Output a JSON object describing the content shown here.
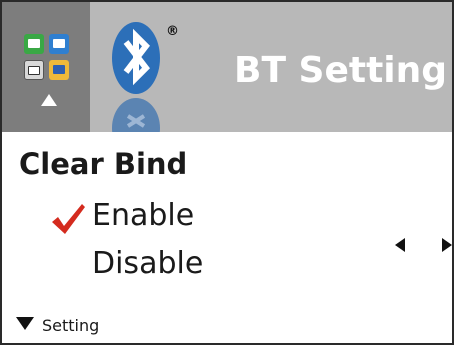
{
  "header": {
    "title": "BT Setting",
    "registered_mark": "®",
    "menu_icon": "menu-grid-icon",
    "bluetooth_icon": "bluetooth-icon"
  },
  "section": {
    "title": "Clear Bind"
  },
  "options": [
    {
      "label": "Enable",
      "selected": true
    },
    {
      "label": "Disable",
      "selected": false
    }
  ],
  "footer": {
    "label": "Setting"
  },
  "colors": {
    "header_bg": "#b8b8b8",
    "menu_tile_bg": "#7d7d7d",
    "bluetooth_blue": "#2c6fb8",
    "check_red": "#d42b1e",
    "title_white": "#ffffff"
  }
}
